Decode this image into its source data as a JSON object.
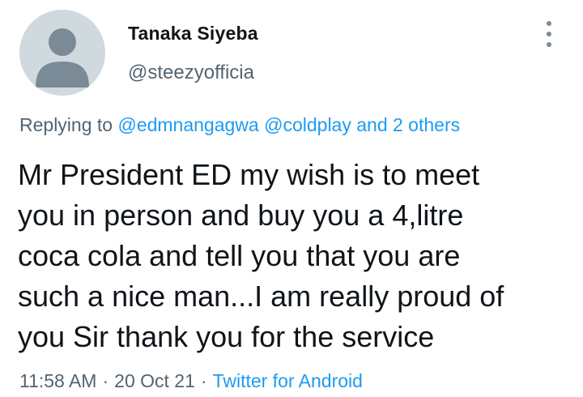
{
  "author": {
    "display_name": "Tanaka Siyeba",
    "handle": "@steezyofficia",
    "avatar_icon": "default-avatar-icon"
  },
  "menu": {
    "icon": "more-vertical-icon"
  },
  "reply": {
    "prefix": "Replying to",
    "mentions": [
      "@edmnangagwa",
      "@coldplay"
    ],
    "and_text": "and",
    "others": "2 others"
  },
  "tweet": {
    "lines": [
      "Mr President ED my wish is to meet",
      "you in person and buy you a 4,litre",
      "coca cola and tell you that you are",
      "such a nice man...I am really proud of",
      "you Sir thank you for the service"
    ]
  },
  "meta": {
    "time": "11:58 AM",
    "date": "20 Oct 21",
    "separator": "·",
    "source": "Twitter for Android"
  },
  "colors": {
    "text": "#0f1419",
    "secondary": "#536471",
    "link": "#1d9bf0",
    "avatar_bg": "#cfd9de",
    "avatar_fg": "#7a8a96"
  }
}
